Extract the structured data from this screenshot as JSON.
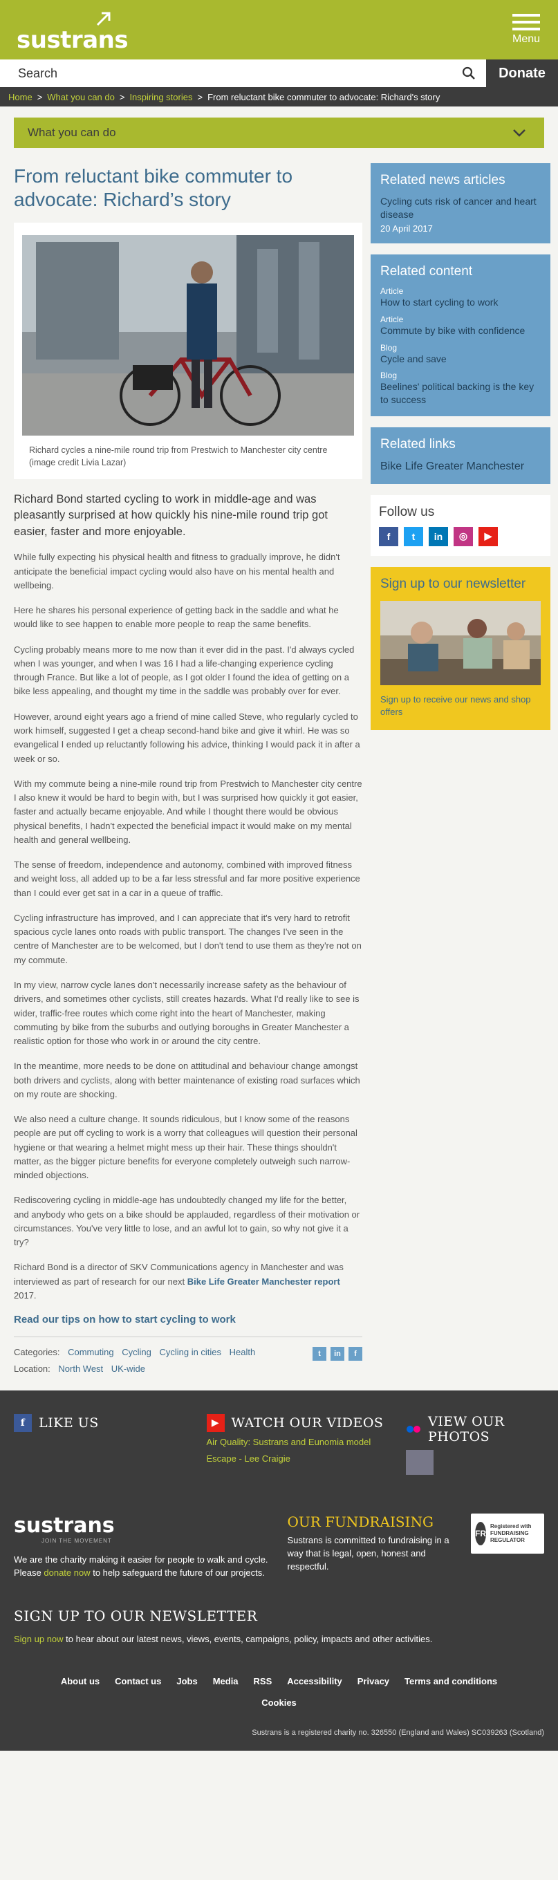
{
  "header": {
    "logo": "sustrans",
    "menu_label": "Menu"
  },
  "search": {
    "placeholder": "Search",
    "donate_label": "Donate"
  },
  "breadcrumb": [
    "Home",
    "What you can do",
    "Inspiring stories",
    "From reluctant bike commuter to advocate: Richard's story"
  ],
  "section_dropdown": "What you can do",
  "article": {
    "title": "From reluctant bike commuter to advocate: Richard’s story",
    "caption": "Richard cycles a nine-mile round trip from Prestwich to Manchester city centre (image credit Livia Lazar)",
    "lead": "Richard Bond started cycling to work in middle-age and was pleasantly surprised at how quickly his nine-mile round trip got easier, faster and more enjoyable.",
    "paragraphs": [
      "While fully expecting his physical health and fitness to gradually improve, he didn't anticipate the beneficial impact cycling would also have on his mental health and wellbeing.",
      "Here he shares his personal experience of getting back in the saddle and what he would like to see happen to enable more people to reap the same benefits.",
      "Cycling probably means more to me now than it ever did in the past. I'd always cycled when I was younger, and when I was 16 I had a life-changing experience cycling through France. But like a lot of people, as I got older I found the idea of getting on a bike less appealing, and thought my time in the saddle was probably over for ever.",
      "However, around eight years ago a friend of mine called Steve, who regularly cycled to work himself, suggested I get a cheap second-hand bike and give it whirl. He was so evangelical I ended up reluctantly following his advice, thinking I would pack it in after a week or so.",
      "With my commute being a nine-mile round trip from Prestwich to Manchester city centre I also knew it would be hard to begin with, but I was surprised how quickly it got easier, faster and actually became enjoyable. And while I thought there would be obvious physical benefits, I hadn't expected the beneficial impact it would make on my mental health and general wellbeing.",
      "The sense of freedom, independence and autonomy, combined with improved fitness and weight loss, all added up to be a far less stressful and far more positive experience than I could ever get sat in a car in a queue of traffic.",
      "Cycling infrastructure has improved, and I can appreciate that it's very hard to retrofit spacious cycle lanes onto roads with public transport. The changes I've seen in the centre of Manchester are to be welcomed, but I don't tend to use them as they're not on my commute.",
      "In my view, narrow cycle lanes don't necessarily increase safety as the behaviour of drivers, and sometimes other cyclists, still creates hazards. What I'd really like to see is wider, traffic-free routes which come right into the heart of Manchester, making commuting by bike from the suburbs and outlying boroughs in Greater Manchester a realistic option for those who work in or around the city centre.",
      "In the meantime, more needs to be done on attitudinal and behaviour change amongst both drivers and cyclists, along with better maintenance of existing road surfaces which on my route are shocking.",
      "We also need a culture change. It sounds ridiculous, but I know some of the reasons people are put off cycling to work is a worry that colleagues will question their personal hygiene or that wearing a helmet might mess up their hair. These things shouldn't matter, as the bigger picture benefits for everyone completely outweigh such narrow-minded objections.",
      "Rediscovering cycling in middle-age has undoubtedly changed my life for the better, and anybody who gets on a bike should be applauded, regardless of their motivation or circumstances. You've very little to lose, and an awful lot to gain, so why not give it a try?"
    ],
    "author_note_text": "Richard Bond is a director of SKV Communications agency in Manchester and was interviewed as part of research for our next ",
    "author_note_link": "Bike Life Greater Manchester report",
    "author_note_end": " 2017.",
    "tips_link": "Read our tips on how to start cycling to work",
    "categories_label": "Categories:",
    "categories": [
      "Commuting",
      "Cycling",
      "Cycling in cities",
      "Health"
    ],
    "location_label": "Location:",
    "locations": [
      "North West",
      "UK-wide"
    ]
  },
  "sidebar": {
    "related_news": {
      "heading": "Related news articles",
      "title": "Cycling cuts risk of cancer and heart disease",
      "date": "20 April 2017"
    },
    "related_content": {
      "heading": "Related content",
      "items": [
        {
          "type": "Article",
          "title": "How to start cycling to work"
        },
        {
          "type": "Article",
          "title": "Commute by bike with confidence"
        },
        {
          "type": "Blog",
          "title": "Cycle and save"
        },
        {
          "type": "Blog",
          "title": "Beelines' political backing is the key to success"
        }
      ]
    },
    "related_links": {
      "heading": "Related links",
      "link": "Bike Life Greater Manchester"
    },
    "follow": {
      "heading": "Follow us"
    },
    "newsletter": {
      "heading": "Sign up to our newsletter",
      "text": "Sign up to receive our news and shop offers"
    }
  },
  "footer": {
    "like": "LIKE US",
    "watch": "WATCH OUR VIDEOS",
    "videos": [
      "Air Quality: Sustrans and Eunomia model",
      "Escape - Lee Craigie"
    ],
    "photos": "VIEW OUR PHOTOS",
    "brand": "sustrans",
    "tagline": "JOIN THE MOVEMENT",
    "charity_pre": "We are the charity making it easier for people to walk and cycle. Please ",
    "charity_link": "donate now",
    "charity_post": " to help safeguard the future of our projects.",
    "fund_heading": "OUR FUNDRAISING",
    "fund_text": "Sustrans is committed to fundraising in a way that is legal, open, honest and respectful.",
    "fr_badge": "FR",
    "fr_text": "Registered with FUNDRAISING REGULATOR",
    "signup_heading": "SIGN UP TO OUR NEWSLETTER",
    "signup_link": "Sign up now",
    "signup_text": " to hear about our latest news, views, events, campaigns, policy, impacts and other activities.",
    "nav": [
      "About us",
      "Contact us",
      "Jobs",
      "Media",
      "RSS",
      "Accessibility",
      "Privacy",
      "Terms and conditions"
    ],
    "cookies": "Cookies",
    "legal": "Sustrans is a registered charity no. 326550 (England and Wales) SC039263 (Scotland)"
  }
}
